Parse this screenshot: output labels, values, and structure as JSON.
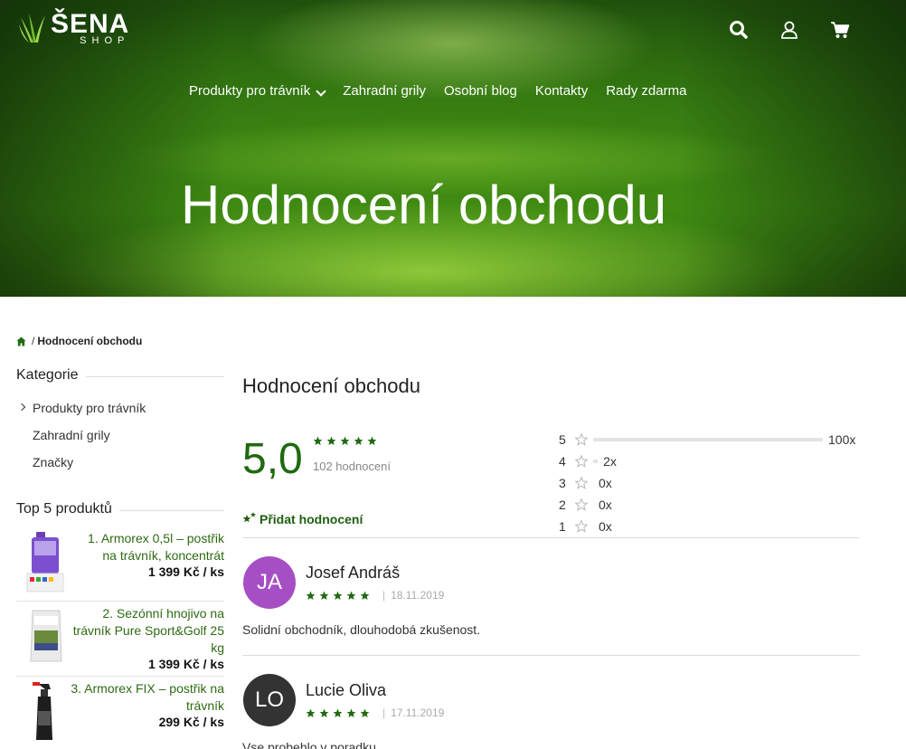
{
  "brand": {
    "name": "ŠENA",
    "sub": "SHOP",
    "accent": "#1f6a10",
    "link": "#2e6b14"
  },
  "header_icons": [
    "search-icon",
    "user-icon",
    "cart-icon"
  ],
  "nav": {
    "items": [
      "Produkty pro trávník",
      "Zahradní grily",
      "Osobní blog",
      "Kontakty",
      "Rady zdarma"
    ]
  },
  "hero": {
    "title": "Hodnocení obchodu"
  },
  "breadcrumb": {
    "sep": "/",
    "current": "Hodnocení obchodu"
  },
  "sidebar": {
    "categories_title": "Kategorie",
    "categories": [
      "Produkty pro trávník",
      "Zahradní grily",
      "Značky"
    ],
    "top_title": "Top 5 produktů",
    "products": [
      {
        "name": "1. Armorex 0,5l – postřik na trávník, koncentrát",
        "price": "1 399 Kč / ks"
      },
      {
        "name": "2. Sezónní hnojivo na trávník Pure Sport&Golf 25 kg",
        "price": "1 399 Kč / ks"
      },
      {
        "name": "3. Armorex FIX – postřik na trávník",
        "price": "299 Kč / ks"
      }
    ]
  },
  "summary": {
    "title": "Hodnocení obchodu",
    "score": "5,0",
    "stars": 5,
    "count": "102 hodnocení",
    "add_review": "Přidat hodnocení",
    "distribution": [
      {
        "level": "5",
        "count": "100x",
        "fraction": 1.0
      },
      {
        "level": "4",
        "count": "2x",
        "fraction": 0.02
      },
      {
        "level": "3",
        "count": "0x",
        "fraction": 0
      },
      {
        "level": "2",
        "count": "0x",
        "fraction": 0
      },
      {
        "level": "1",
        "count": "0x",
        "fraction": 0
      }
    ]
  },
  "reviews": [
    {
      "initials": "JA",
      "name": "Josef Andráš",
      "stars": 5,
      "date": "18.11.2019",
      "text": "Solidní obchodník, dlouhodobá zkušenost.",
      "color": "#a64fc4"
    },
    {
      "initials": "LO",
      "name": "Lucie Oliva",
      "stars": 5,
      "date": "17.11.2019",
      "text": "Vse probehlo v poradku",
      "color": "#333333"
    }
  ]
}
